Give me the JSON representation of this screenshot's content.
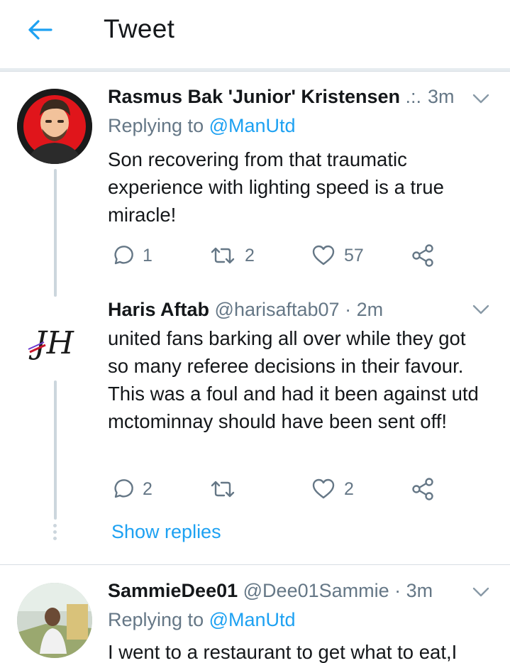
{
  "header": {
    "title": "Tweet",
    "back_icon": "arrow-left-icon",
    "accent": "#1da1f2"
  },
  "tweets": [
    {
      "name": "Rasmus Bak 'Junior' Kristensen",
      "meta": " .:.",
      "time": "3m",
      "reply_label": "Replying to",
      "reply_handle": "@ManUtd",
      "text": "Son recovering from that traumatic experience with lighting speed is a true miracle!",
      "replies": "1",
      "retweets": "2",
      "likes": "57"
    },
    {
      "name": "Haris Aftab",
      "handle": "@harisaftab07",
      "time": "· 2m",
      "text": "united fans barking all over while they got so many referee decisions in their favour. This was a foul and had it been against utd mctominnay should have been sent off!",
      "replies": "2",
      "retweets": "",
      "likes": "2",
      "avatar_text": "JH"
    },
    {
      "name": "SammieDee01",
      "handle": "@Dee01Sammie",
      "time": "· 3m",
      "reply_label": "Replying to",
      "reply_handle": "@ManUtd",
      "text": "I went to a restaurant to get what to eat,I"
    }
  ],
  "show_replies": "Show replies"
}
